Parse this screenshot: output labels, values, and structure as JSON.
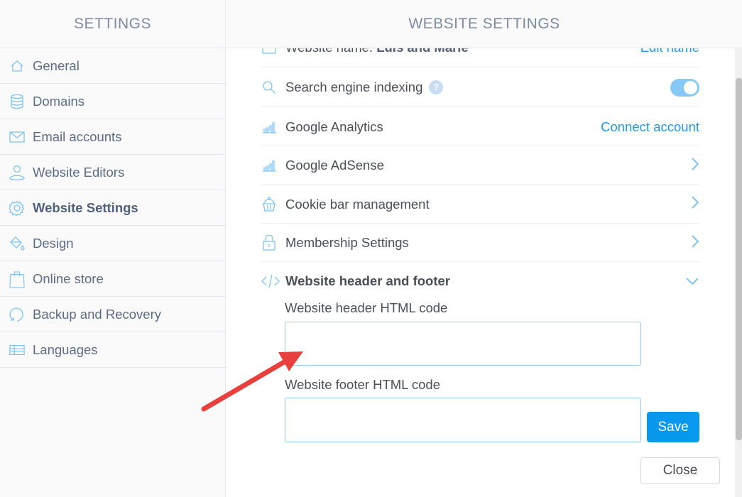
{
  "sidebar": {
    "title": "SETTINGS",
    "items": [
      {
        "label": "General",
        "icon": "home-icon"
      },
      {
        "label": "Domains",
        "icon": "database-icon"
      },
      {
        "label": "Email accounts",
        "icon": "envelope-icon"
      },
      {
        "label": "Website Editors",
        "icon": "user-icon"
      },
      {
        "label": "Website Settings",
        "icon": "gear-icon",
        "active": true
      },
      {
        "label": "Design",
        "icon": "paint-bucket-icon"
      },
      {
        "label": "Online store",
        "icon": "shopping-bag-icon"
      },
      {
        "label": "Backup and Recovery",
        "icon": "refresh-icon"
      },
      {
        "label": "Languages",
        "icon": "languages-grid-icon"
      }
    ]
  },
  "main": {
    "title": "WEBSITE SETTINGS",
    "website_name": {
      "label": "Website name:",
      "value": "Luis and Marie",
      "action": "Edit name"
    },
    "indexing": {
      "label": "Search engine indexing",
      "help": "?",
      "enabled": true
    },
    "analytics": {
      "label": "Google Analytics",
      "action": "Connect account"
    },
    "adsense": {
      "label": "Google AdSense"
    },
    "cookie": {
      "label": "Cookie bar management"
    },
    "membership": {
      "label": "Membership Settings"
    },
    "header_footer": {
      "label": "Website header and footer",
      "header_label": "Website header HTML code",
      "header_value": "",
      "footer_label": "Website footer HTML code",
      "footer_value": "",
      "save": "Save"
    },
    "close": "Close"
  },
  "colors": {
    "accent": "#1e9ae6",
    "save": "#0898ee",
    "icon": "#7cc4f4",
    "arrow": "#e8403c"
  }
}
